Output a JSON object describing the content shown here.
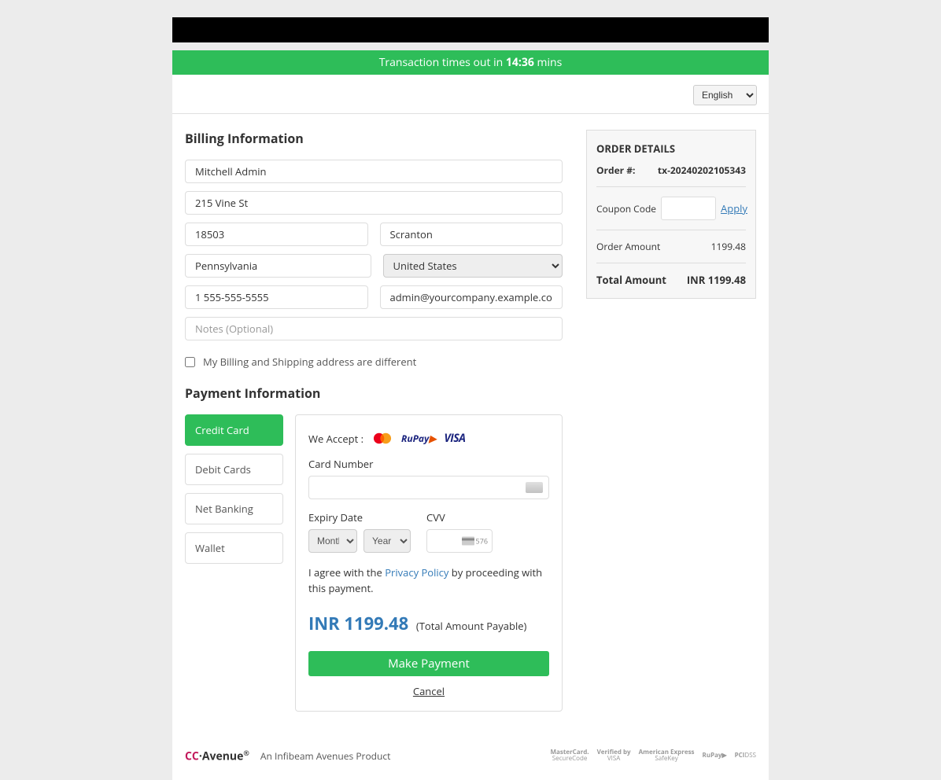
{
  "timeout": {
    "prefix": "Transaction times out in ",
    "time": "14:36",
    "suffix": " mins"
  },
  "language": {
    "selected": "English"
  },
  "billing": {
    "title": "Billing Information",
    "name": "Mitchell Admin",
    "address": "215 Vine St",
    "zip": "18503",
    "city": "Scranton",
    "state": "Pennsylvania",
    "country": "United States",
    "phone": "1 555-555-5555",
    "email": "admin@yourcompany.example.com",
    "notes_placeholder": "Notes (Optional)",
    "diff_address_label": "My Billing and Shipping address are different"
  },
  "payment": {
    "title": "Payment Information",
    "methods": [
      "Credit Card",
      "Debit Cards",
      "Net Banking",
      "Wallet"
    ],
    "we_accept_label": "We Accept :",
    "card_number_label": "Card Number",
    "expiry_label": "Expiry Date",
    "cvv_label": "CVV",
    "month_placeholder": "Month",
    "year_placeholder": "Year",
    "agree_prefix": "I agree with the ",
    "privacy_link": "Privacy Policy",
    "agree_suffix": " by proceeding with this payment.",
    "amount_payable": "INR 1199.48",
    "amount_sub": "(Total Amount Payable)",
    "make_payment": "Make Payment",
    "cancel": "Cancel"
  },
  "order": {
    "title": "ORDER DETAILS",
    "order_no_label": "Order  #:",
    "order_no_value": "tx-20240202105343",
    "coupon_label": "Coupon Code",
    "apply_label": "Apply",
    "order_amount_label": "Order   Amount",
    "order_amount_value": "1199.48",
    "total_label": "Total Amount",
    "total_value": "INR 1199.48"
  },
  "footer": {
    "tagline": "An Infibeam Avenues Product"
  }
}
